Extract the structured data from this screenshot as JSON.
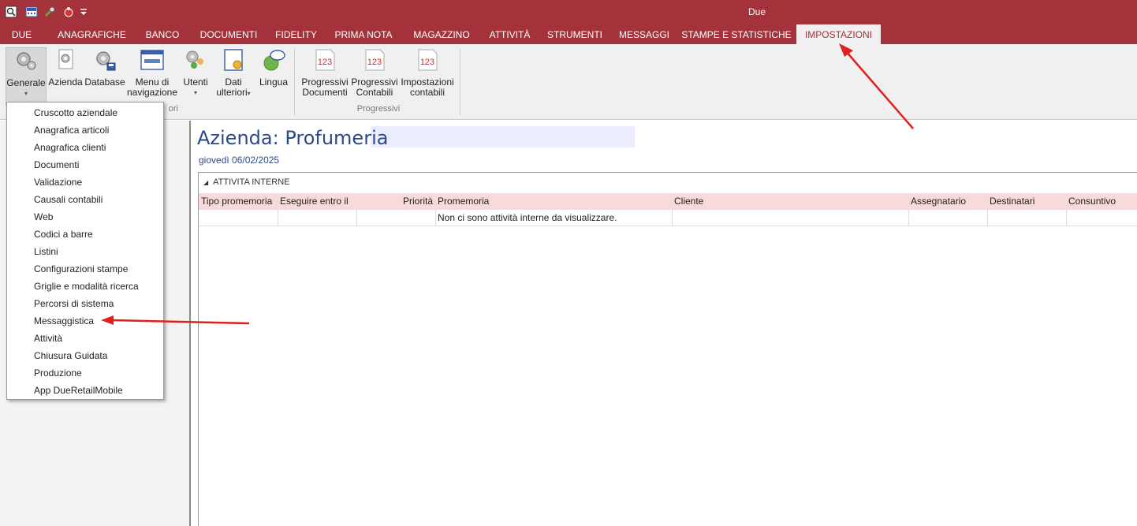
{
  "window": {
    "title": "Due"
  },
  "tabs": [
    "DUE",
    "ANAGRAFICHE",
    "BANCO",
    "DOCUMENTI",
    "FIDELITY",
    "PRIMA NOTA",
    "MAGAZZINO",
    "ATTIVITÀ",
    "STRUMENTI",
    "MESSAGGI",
    "STAMPE E STATISTICHE",
    "IMPOSTAZIONI"
  ],
  "active_tab": "IMPOSTAZIONI",
  "ribbon": {
    "generale": "Generale",
    "azienda": "Azienda",
    "database": "Database",
    "menu_line1": "Menu di",
    "menu_line2": "navigazione",
    "utenti": "Utenti",
    "dati_line1": "Dati",
    "dati_line2": "ulteriori",
    "lingua": "Lingua",
    "prog_doc_line1": "Progressivi",
    "prog_doc_line2": "Documenti",
    "prog_cont_line1": "Progressivi",
    "prog_cont_line2": "Contabili",
    "imp_cont_line1": "Impostazioni",
    "imp_cont_line2": "contabili",
    "group_partial": "ori",
    "group_progressivi": "Progressivi",
    "icon_number": "123"
  },
  "dropdown": {
    "items": [
      "Cruscotto aziendale",
      "Anagrafica articoli",
      "Anagrafica clienti",
      "Documenti",
      "Validazione",
      "Causali contabili",
      "Web",
      "Codici a barre",
      "Listini",
      "Configurazioni stampe",
      "Griglie e modalità ricerca",
      "Percorsi di sistema",
      "Messaggistica",
      "Attività",
      "Chiusura Guidata",
      "Produzione",
      "App DueRetailMobile"
    ]
  },
  "main": {
    "company_title": "Azienda: Profumeria",
    "date": "giovedì 06/02/2025",
    "grid": {
      "group": "ATTIVITA INTERNE",
      "columns": [
        "Tipo promemoria",
        "Eseguire entro il",
        "Priorità",
        "Promemoria",
        "Cliente",
        "Assegnatario",
        "Destinatari",
        "Consuntivo"
      ],
      "empty_message": "Non ci sono attività interne da visualizzare."
    }
  },
  "colors": {
    "brand": "#a4323a",
    "header_row": "#f9dada",
    "title_text": "#2c4a8a",
    "annotation_arrow": "#e0201c"
  }
}
